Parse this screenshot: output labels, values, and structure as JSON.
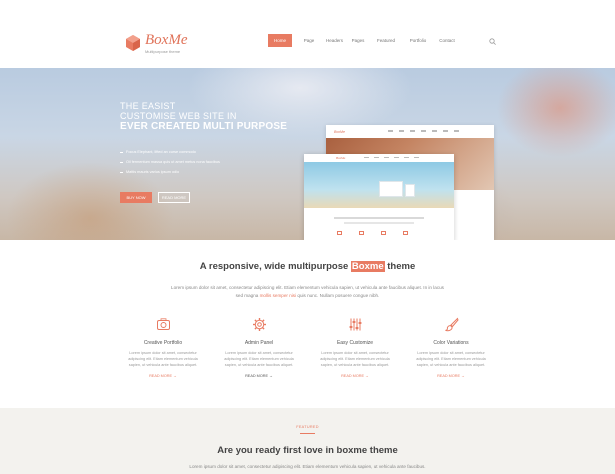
{
  "header": {
    "brand": "BoxMe",
    "tagline": "Multipurpose theme",
    "nav": [
      "Home",
      "Page",
      "Headers",
      "Pages",
      "Featured",
      "Portfolio",
      "Contact"
    ]
  },
  "hero": {
    "line1": "THE EASIST",
    "line2": "CUSTOMISE WEB SITE IN",
    "line3": "EVER CREATED MULTI PURPOSE",
    "bullets": [
      "Focus Elephant, lifted an curse commodo",
      "Oil fermentum massa quis ut amet metus nona faucibus",
      "Mattis mauris varius ipsum odio"
    ],
    "buy_label": "BUY NOW",
    "read_label": "READ MORE"
  },
  "intro": {
    "title_before": "A responsive, wide multipurpose",
    "title_highlight": "Boxme",
    "title_after": "theme",
    "text_before": "Lorem ipsum dolor sit amet, consectetur adipiscing elit. Etiam elementum vehicula sapien, ut vehicula ante faucibus aliquet. In in lacus sed magna",
    "text_link": "mollis semper nisi",
    "text_after": "quis nunc. Nullam posuere congue nibh."
  },
  "features": [
    {
      "title": "Creative Portfolio",
      "text": "Lorem ipsum dolor sit amet, consectetur adipiscing elit. Etiam elementum vehicula sapien, ut vehicula ante faucibus aliquet.",
      "more": "READ MORE →"
    },
    {
      "title": "Admin Panel",
      "text": "Lorem ipsum dolor sit amet, consectetur adipiscing elit. Etiam elementum vehicula sapien, ut vehicula ante faucibus aliquet.",
      "more": "READ MORE →"
    },
    {
      "title": "Easy Customize",
      "text": "Lorem ipsum dolor sit amet, consectetur adipiscing elit. Etiam elementum vehicula sapien, ut vehicula ante faucibus aliquet.",
      "more": "READ MORE →"
    },
    {
      "title": "Color Variations",
      "text": "Lorem ipsum dolor sit amet, consectetur adipiscing elit. Etiam elementum vehicula sapien, ut vehicula ante faucibus aliquet.",
      "more": "READ MORE →"
    }
  ],
  "featured": {
    "tag": "FEATURED",
    "title": "Are you ready first love in boxme theme",
    "text": "Lorem ipsum dolor sit amet, consectetur adipiscing elit. Etiam elementum vehicula sapien, ut vehicula ante faucibus."
  },
  "icons": {
    "logo": "hexagon-box-icon",
    "search": "search-icon",
    "feature_1": "camera-icon",
    "feature_2": "gear-icon",
    "feature_3": "sliders-icon",
    "feature_4": "paint-brush-icon"
  },
  "colors": {
    "accent": "#e87b62",
    "heading": "#444444",
    "body_text": "#888888",
    "featured_bg": "#f3f2ee"
  }
}
